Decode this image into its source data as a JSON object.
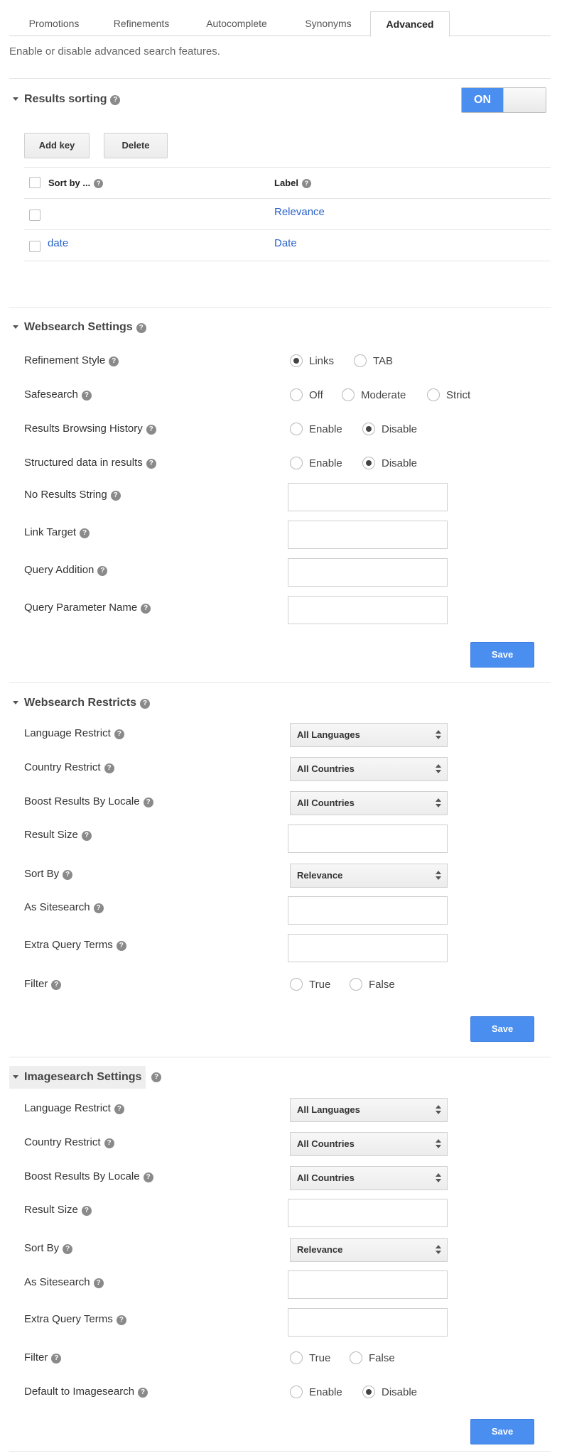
{
  "tabs": [
    "Promotions",
    "Refinements",
    "Autocomplete",
    "Synonyms",
    "Advanced"
  ],
  "active_tab": "Advanced",
  "intro": "Enable or disable advanced search features.",
  "help_glyph": "?",
  "results_sorting": {
    "title": "Results sorting",
    "toggle_label": "ON",
    "add_key": "Add key",
    "delete": "Delete",
    "col_sort_by": "Sort by ...",
    "col_label": "Label",
    "rows": [
      {
        "sort_by": "",
        "label": "Relevance"
      },
      {
        "sort_by": "date",
        "label": "Date"
      }
    ]
  },
  "websearch_settings": {
    "title": "Websearch Settings",
    "refinement_style": {
      "label": "Refinement Style",
      "options": [
        "Links",
        "TAB"
      ],
      "selected": "Links"
    },
    "safesearch": {
      "label": "Safesearch",
      "options": [
        "Off",
        "Moderate",
        "Strict"
      ],
      "selected": ""
    },
    "results_browsing_history": {
      "label": "Results Browsing History",
      "options": [
        "Enable",
        "Disable"
      ],
      "selected": "Disable"
    },
    "structured_data": {
      "label": "Structured data in results",
      "options": [
        "Enable",
        "Disable"
      ],
      "selected": "Disable"
    },
    "no_results_string": {
      "label": "No Results String",
      "value": ""
    },
    "link_target": {
      "label": "Link Target",
      "value": ""
    },
    "query_addition": {
      "label": "Query Addition",
      "value": ""
    },
    "query_parameter_name": {
      "label": "Query Parameter Name",
      "value": ""
    },
    "save": "Save"
  },
  "websearch_restricts": {
    "title": "Websearch Restricts",
    "language_restrict": {
      "label": "Language Restrict",
      "value": "All Languages"
    },
    "country_restrict": {
      "label": "Country Restrict",
      "value": "All Countries"
    },
    "boost_locale": {
      "label": "Boost Results By Locale",
      "value": "All Countries"
    },
    "result_size": {
      "label": "Result Size",
      "value": ""
    },
    "sort_by": {
      "label": "Sort By",
      "value": "Relevance"
    },
    "as_sitesearch": {
      "label": "As Sitesearch",
      "value": ""
    },
    "extra_query_terms": {
      "label": "Extra Query Terms",
      "value": ""
    },
    "filter": {
      "label": "Filter",
      "options": [
        "True",
        "False"
      ],
      "selected": ""
    },
    "save": "Save"
  },
  "imagesearch_settings": {
    "title": "Imagesearch Settings",
    "language_restrict": {
      "label": "Language Restrict",
      "value": "All Languages"
    },
    "country_restrict": {
      "label": "Country Restrict",
      "value": "All Countries"
    },
    "boost_locale": {
      "label": "Boost Results By Locale",
      "value": "All Countries"
    },
    "result_size": {
      "label": "Result Size",
      "value": ""
    },
    "sort_by": {
      "label": "Sort By",
      "value": "Relevance"
    },
    "as_sitesearch": {
      "label": "As Sitesearch",
      "value": ""
    },
    "extra_query_terms": {
      "label": "Extra Query Terms",
      "value": ""
    },
    "filter": {
      "label": "Filter",
      "options": [
        "True",
        "False"
      ],
      "selected": ""
    },
    "default_to_imagesearch": {
      "label": "Default to Imagesearch",
      "options": [
        "Enable",
        "Disable"
      ],
      "selected": "Disable"
    },
    "save": "Save"
  },
  "colors": {
    "accent": "#4a8ef0",
    "link": "#2a62c9"
  }
}
